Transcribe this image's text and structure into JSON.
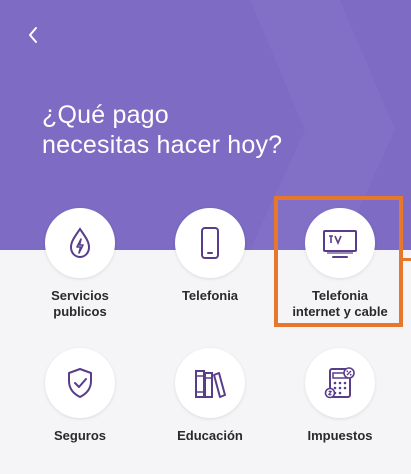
{
  "header": {
    "back_icon": "chevron-left-icon",
    "title_line1": "¿Qué pago",
    "title_line2": "necesitas hacer hoy?"
  },
  "colors": {
    "header_bg": "#7d6bc4",
    "icon_stroke": "#5a3d8a",
    "highlight": "#e8772e"
  },
  "tiles": [
    {
      "icon": "drop-bolt-icon",
      "label_lines": [
        "Servicios",
        "publicos"
      ]
    },
    {
      "icon": "phone-icon",
      "label_lines": [
        "Telefonia"
      ]
    },
    {
      "icon": "tv-icon",
      "label_lines": [
        "Telefonia",
        "internet y cable"
      ]
    },
    {
      "icon": "shield-check-icon",
      "label_lines": [
        "Seguros"
      ]
    },
    {
      "icon": "books-icon",
      "label_lines": [
        "Educación"
      ]
    },
    {
      "icon": "calculator-icon",
      "label_lines": [
        "Impuestos"
      ]
    }
  ]
}
